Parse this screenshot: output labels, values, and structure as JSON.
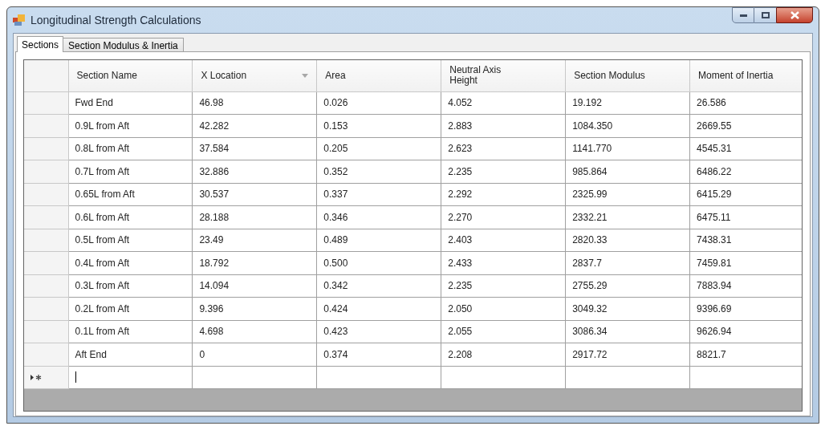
{
  "window": {
    "title": "Longitudinal Strength Calculations"
  },
  "tabs": [
    {
      "label": "Sections",
      "selected": true
    },
    {
      "label": "Section Modulus & Inertia",
      "selected": false
    }
  ],
  "table": {
    "columns": [
      {
        "label": "Section Name",
        "sorted": false
      },
      {
        "label": "X Location",
        "sorted": true
      },
      {
        "label": "Area",
        "sorted": false
      },
      {
        "label": "Neutral Axis Height",
        "sorted": false
      },
      {
        "label": "Section Modulus",
        "sorted": false
      },
      {
        "label": "Moment of Inertia",
        "sorted": false
      }
    ],
    "rows": [
      [
        "Fwd End",
        "46.98",
        "0.026",
        "4.052",
        "19.192",
        "26.586"
      ],
      [
        "0.9L from Aft",
        "42.282",
        "0.153",
        "2.883",
        "1084.350",
        "2669.55"
      ],
      [
        "0.8L from Aft",
        "37.584",
        "0.205",
        "2.623",
        "1141.770",
        "4545.31"
      ],
      [
        "0.7L from Aft",
        "32.886",
        "0.352",
        "2.235",
        "985.864",
        "6486.22"
      ],
      [
        "0.65L from Aft",
        "30.537",
        "0.337",
        "2.292",
        "2325.99",
        "6415.29"
      ],
      [
        "0.6L from Aft",
        "28.188",
        "0.346",
        "2.270",
        "2332.21",
        "6475.11"
      ],
      [
        "0.5L from Aft",
        "23.49",
        "0.489",
        "2.403",
        "2820.33",
        "7438.31"
      ],
      [
        "0.4L from Aft",
        "18.792",
        "0.500",
        "2.433",
        "2837.7",
        "7459.81"
      ],
      [
        "0.3L from Aft",
        "14.094",
        "0.342",
        "2.235",
        "2755.29",
        "7883.94"
      ],
      [
        "0.2L from Aft",
        "9.396",
        "0.424",
        "2.050",
        "3049.32",
        "9396.69"
      ],
      [
        "0.1L from Aft",
        "4.698",
        "0.423",
        "2.055",
        "3086.34",
        "9626.94"
      ],
      [
        "Aft End",
        "0",
        "0.374",
        "2.208",
        "2917.72",
        "8821.7"
      ]
    ],
    "new_row": {
      "editing": true
    }
  }
}
